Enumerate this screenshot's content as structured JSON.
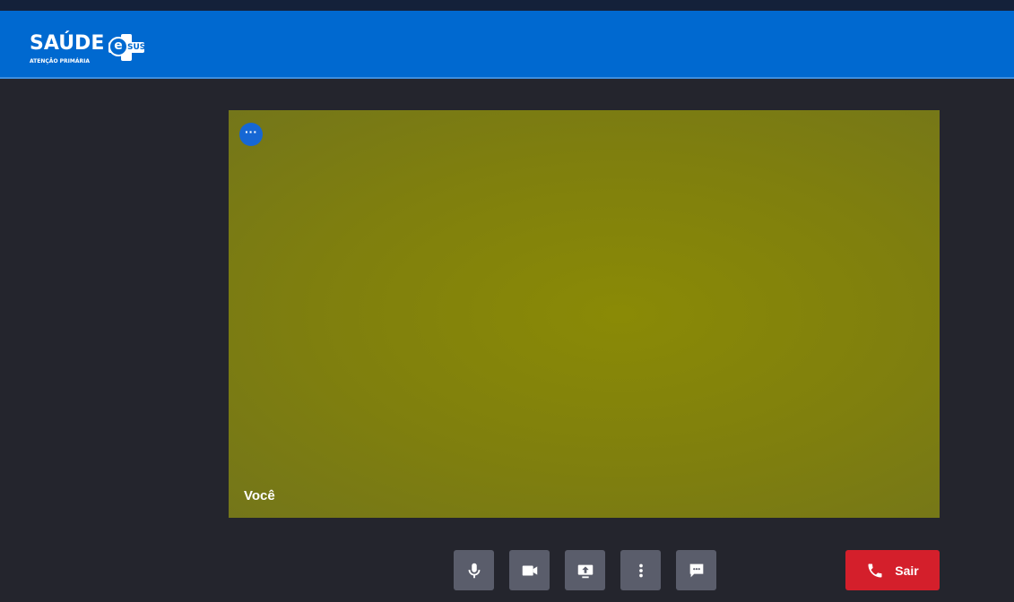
{
  "header": {
    "logo_title": "SAÚDE",
    "logo_subtitle": "ATENÇÃO PRIMÁRIA",
    "logo_badge_letter": "e",
    "logo_badge_text": "SUS",
    "brand_color": "#0069d0"
  },
  "video": {
    "participant_label": "Você",
    "menu_icon": "more-horizontal-icon"
  },
  "controls": {
    "icons": [
      "microphone-icon",
      "camera-icon",
      "screen-share-icon",
      "more-vertical-icon",
      "chat-icon"
    ],
    "leave_label": "Sair",
    "leave_icon": "phone-icon",
    "leave_color": "#d41f2b"
  }
}
